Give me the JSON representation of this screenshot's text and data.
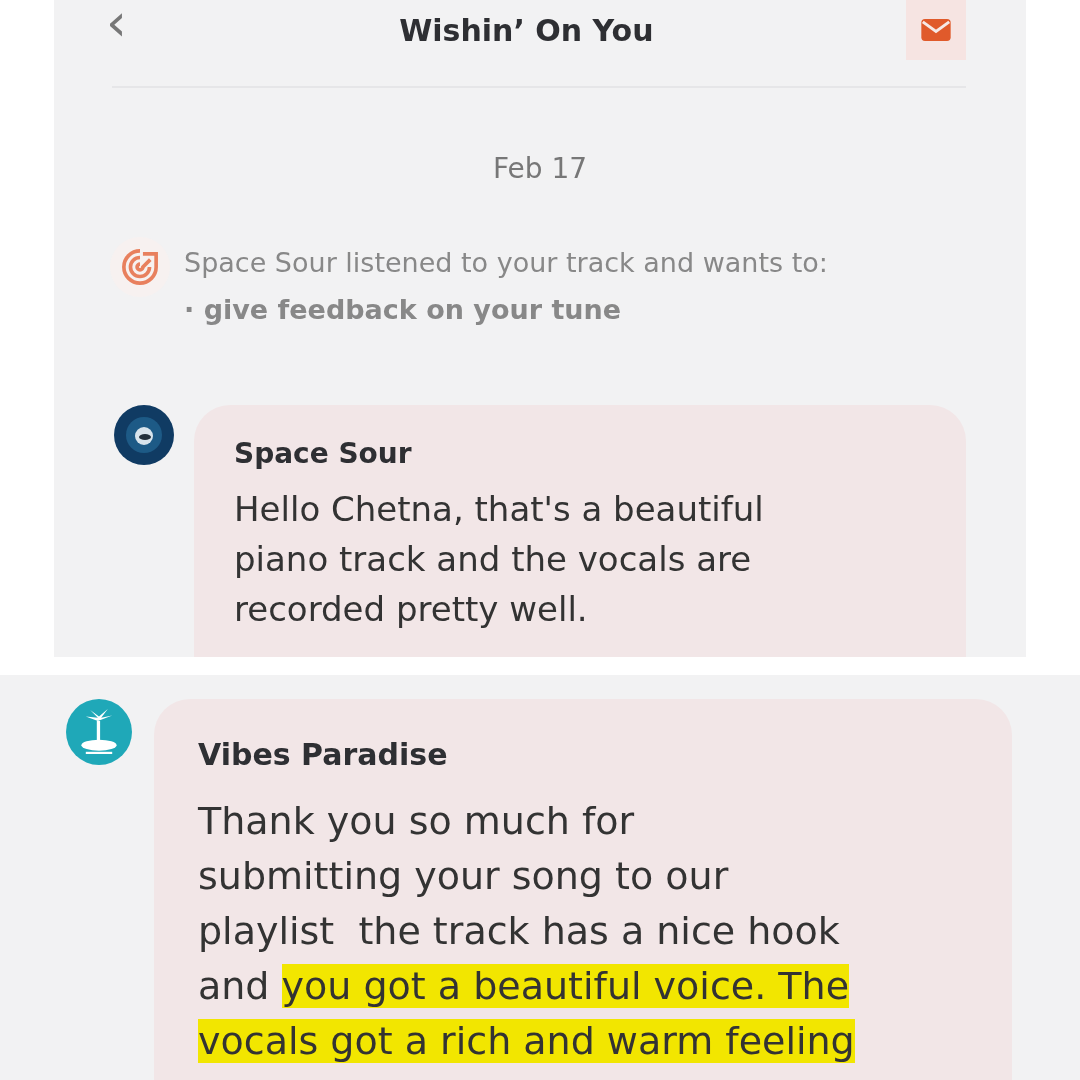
{
  "panels": [
    {
      "header": {
        "back": "‹",
        "title": "Wishin’ On You"
      },
      "date": "Feb 17",
      "notice": {
        "text": "Space Sour listened to your track and wants to:",
        "items": [
          "· give feedback on your tune"
        ]
      },
      "message": {
        "sender": "Space Sour",
        "lines": [
          [
            {
              "text": "Hello Chetna, that's a beautiful",
              "highlighted": false
            }
          ],
          [
            {
              "text": "piano track and the vocals are",
              "highlighted": false
            }
          ],
          [
            {
              "text": "recorded pretty well.",
              "highlighted": false
            }
          ]
        ]
      }
    },
    {
      "message": {
        "sender": "Vibes Paradise",
        "lines": [
          [
            {
              "text": "Thank you so much for",
              "highlighted": false
            }
          ],
          [
            {
              "text": "submitting your song to our",
              "highlighted": false
            }
          ],
          [
            {
              "text": "playlist  the track has a nice hook",
              "highlighted": false
            }
          ],
          [
            {
              "text": "and ",
              "highlighted": false
            },
            {
              "text": "you got a beautiful voice. The",
              "highlighted": true
            }
          ],
          [
            {
              "text": "vocals got a rich and warm feeling",
              "highlighted": true
            }
          ]
        ]
      }
    }
  ]
}
